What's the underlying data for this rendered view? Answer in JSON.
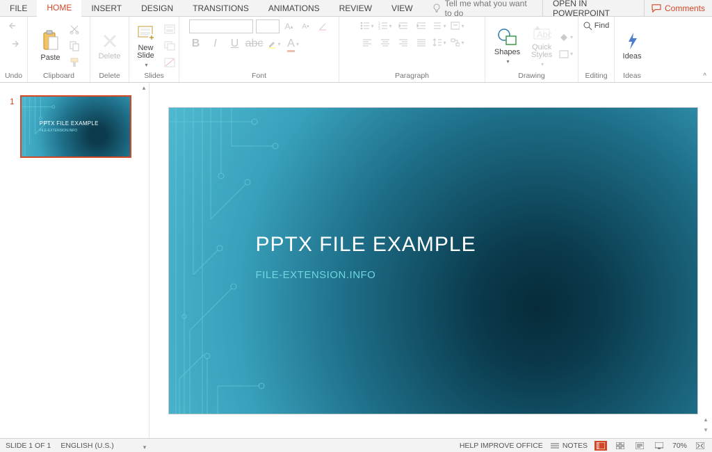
{
  "tabs": {
    "file": "FILE",
    "home": "HOME",
    "insert": "INSERT",
    "design": "DESIGN",
    "transitions": "TRANSITIONS",
    "animations": "ANIMATIONS",
    "review": "REVIEW",
    "view": "VIEW",
    "tell_me": "Tell me what you want to do",
    "open_in": "OPEN IN POWERPOINT",
    "comments": "Comments"
  },
  "ribbon": {
    "undo": {
      "label": "Undo"
    },
    "clipboard": {
      "label": "Clipboard",
      "paste": "Paste"
    },
    "delete": {
      "label": "Delete",
      "btn": "Delete"
    },
    "slides": {
      "label": "Slides",
      "new_slide": "New\nSlide"
    },
    "font": {
      "label": "Font",
      "name": "",
      "size": ""
    },
    "paragraph": {
      "label": "Paragraph"
    },
    "drawing": {
      "label": "Drawing",
      "shapes": "Shapes",
      "quick_styles": "Quick\nStyles"
    },
    "editing": {
      "label": "Editing",
      "find": "Find"
    },
    "ideas": {
      "label": "Ideas",
      "btn": "Ideas"
    }
  },
  "slide": {
    "number": "1",
    "title": "PPTX FILE EXAMPLE",
    "subtitle": "FILE-EXTENSION.INFO"
  },
  "status": {
    "slide_of": "SLIDE 1 OF 1",
    "language": "ENGLISH (U.S.)",
    "help": "HELP IMPROVE OFFICE",
    "notes": "NOTES",
    "zoom": "70%"
  }
}
